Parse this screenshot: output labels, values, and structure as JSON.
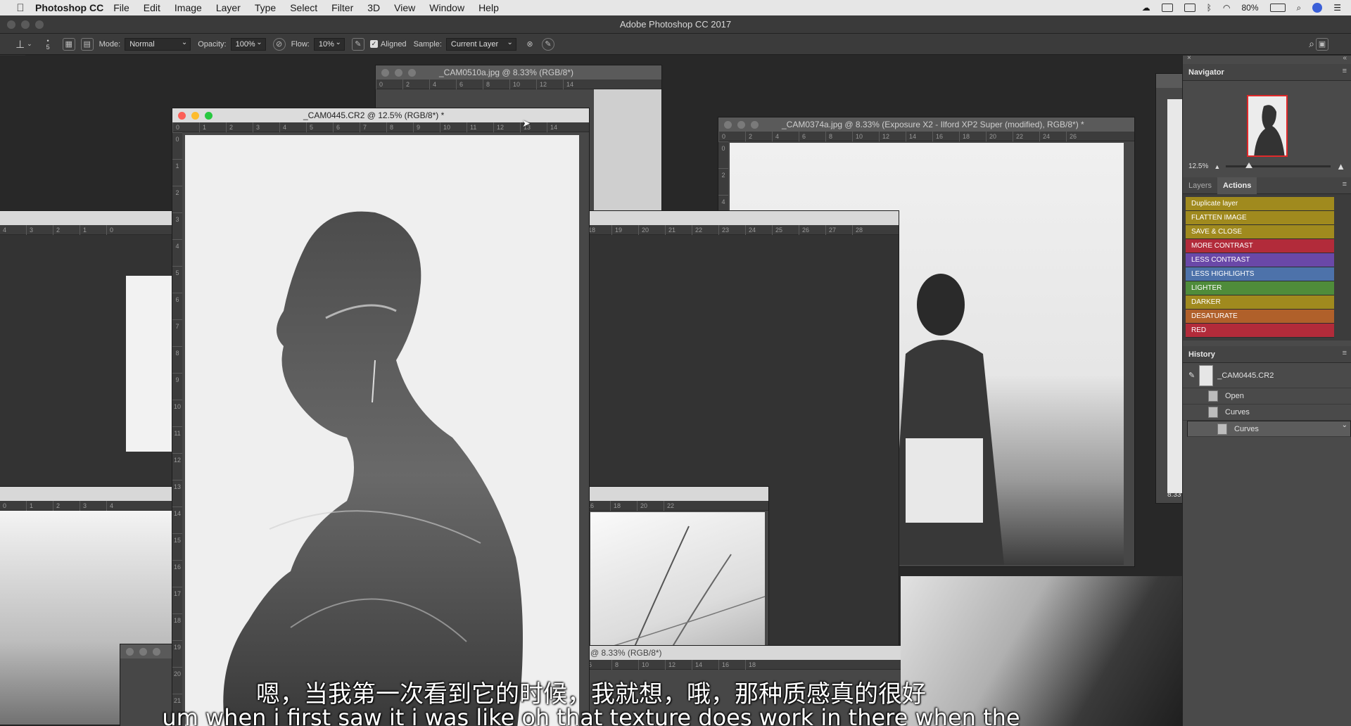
{
  "menubar": {
    "app_name": "Photoshop CC",
    "items": [
      "File",
      "Edit",
      "Image",
      "Layer",
      "Type",
      "Select",
      "Filter",
      "3D",
      "View",
      "Window",
      "Help"
    ],
    "battery": "80%"
  },
  "window_title": "Adobe Photoshop CC 2017",
  "options": {
    "brush_size": "5",
    "mode_label": "Mode:",
    "mode_value": "Normal",
    "opacity_label": "Opacity:",
    "opacity_value": "100%",
    "flow_label": "Flow:",
    "flow_value": "10%",
    "aligned_label": "Aligned",
    "sample_label": "Sample:",
    "sample_value": "Current Layer"
  },
  "documents": {
    "front": "_CAM0445.CR2 @ 12.5% (RGB/8*) *",
    "back1": "_CAM0510a.jpg @ 8.33% (RGB/8*)",
    "back2": "_CAM0374a.jpg @ 8.33% (Exposure X2 - Ilford XP2 Super (modified), RGB/8*) *",
    "back3": "@ 8.33% (RGB/8*)",
    "side_zoom": "8.33"
  },
  "navigator": {
    "title": "Navigator",
    "zoom": "12.5%"
  },
  "actions_panel": {
    "tabs": [
      "Layers",
      "Actions"
    ],
    "items": [
      {
        "label": "Duplicate layer",
        "color": "#a08a1e"
      },
      {
        "label": "FLATTEN IMAGE",
        "color": "#a08a1e"
      },
      {
        "label": "SAVE & CLOSE",
        "color": "#a08a1e"
      },
      {
        "label": "MORE CONTRAST",
        "color": "#b22b3a"
      },
      {
        "label": "LESS CONTRAST",
        "color": "#6a48a8"
      },
      {
        "label": "LESS HIGHLIGHTS",
        "color": "#4d72aa"
      },
      {
        "label": "LIGHTER",
        "color": "#4f8c3a"
      },
      {
        "label": "DARKER",
        "color": "#a08a1e"
      },
      {
        "label": "DESATURATE",
        "color": "#b0602a"
      },
      {
        "label": "RED",
        "color": "#b22b3a"
      }
    ]
  },
  "history": {
    "title": "History",
    "snapshot": "_CAM0445.CR2",
    "steps": [
      "Open",
      "Curves",
      "Curves"
    ]
  },
  "subtitles": {
    "zh": "嗯，当我第一次看到它的时候，我就想，哦，那种质感真的很好",
    "en": "um when i first saw it i was like oh that texture does work in there when the"
  }
}
